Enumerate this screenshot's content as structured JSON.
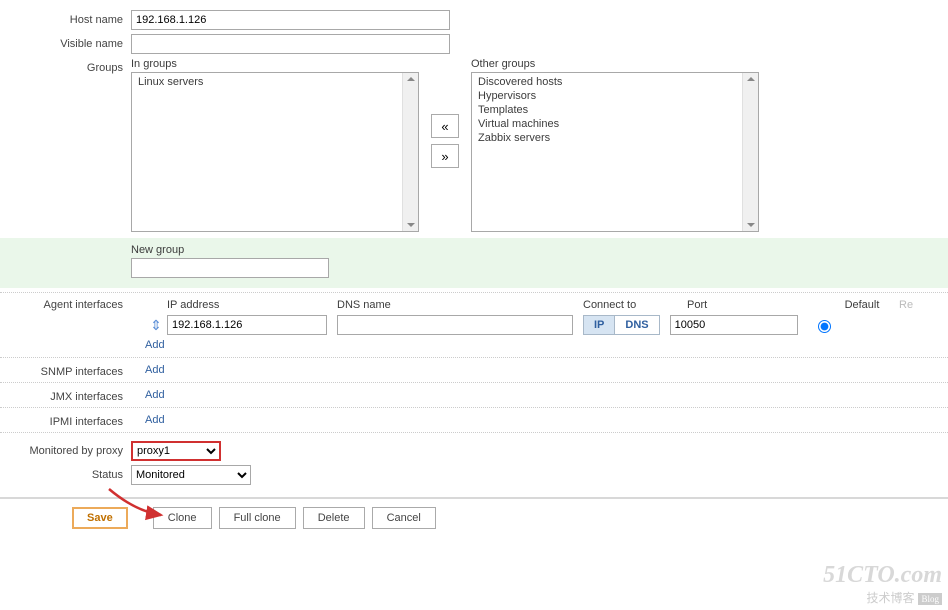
{
  "labels": {
    "host_name": "Host name",
    "visible_name": "Visible name",
    "groups": "Groups",
    "in_groups": "In groups",
    "other_groups": "Other groups",
    "new_group": "New group",
    "agent_if": "Agent interfaces",
    "snmp_if": "SNMP interfaces",
    "jmx_if": "JMX interfaces",
    "ipmi_if": "IPMI interfaces",
    "ip_address": "IP address",
    "dns_name": "DNS name",
    "connect_to": "Connect to",
    "port": "Port",
    "default": "Default",
    "remove": "Re",
    "add": "Add",
    "mon_by_proxy": "Monitored by proxy",
    "status": "Status"
  },
  "host_name": "192.168.1.126",
  "visible_name": "",
  "in_groups": [
    "Linux servers"
  ],
  "other_groups": [
    "Discovered hosts",
    "Hypervisors",
    "Templates",
    "Virtual machines",
    "Zabbix servers"
  ],
  "move_left": "«",
  "move_right": "»",
  "new_group_value": "",
  "agent_interface": {
    "ip": "192.168.1.126",
    "dns": "",
    "connect_ip": "IP",
    "connect_dns": "DNS",
    "port": "10050"
  },
  "proxy_value": "proxy1",
  "status_value": "Monitored",
  "buttons": {
    "save": "Save",
    "clone": "Clone",
    "full_clone": "Full clone",
    "delete": "Delete",
    "cancel": "Cancel"
  },
  "watermark": {
    "line1": "51CTO.com",
    "line2": "技术博客",
    "tag": "Blog"
  }
}
